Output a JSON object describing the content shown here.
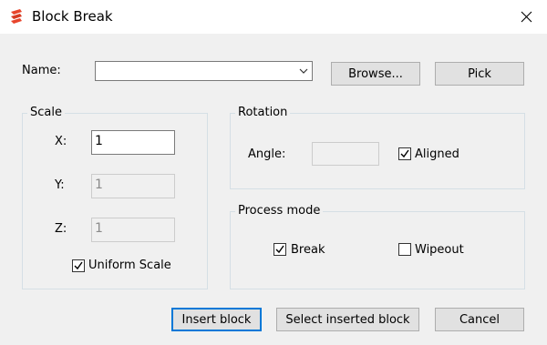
{
  "window": {
    "title": "Block Break",
    "app_icon": "app-logo-icon",
    "close_icon": "close-icon"
  },
  "name_row": {
    "label": "Name:",
    "value": "",
    "browse_label": "Browse...",
    "pick_label": "Pick"
  },
  "scale": {
    "title": "Scale",
    "x_label": "X:",
    "x_value": "1",
    "y_label": "Y:",
    "y_value": "1",
    "z_label": "Z:",
    "z_value": "1",
    "uniform_label": "Uniform Scale",
    "uniform_checked": true
  },
  "rotation": {
    "title": "Rotation",
    "angle_label": "Angle:",
    "angle_value": "",
    "aligned_label": "Aligned",
    "aligned_checked": true
  },
  "process_mode": {
    "title": "Process mode",
    "break_label": "Break",
    "break_checked": true,
    "wipeout_label": "Wipeout",
    "wipeout_checked": false
  },
  "footer": {
    "insert_label": "Insert block",
    "select_label": "Select inserted block",
    "cancel_label": "Cancel"
  },
  "colors": {
    "accent": "#0078d7",
    "logo": "#e8452c"
  }
}
